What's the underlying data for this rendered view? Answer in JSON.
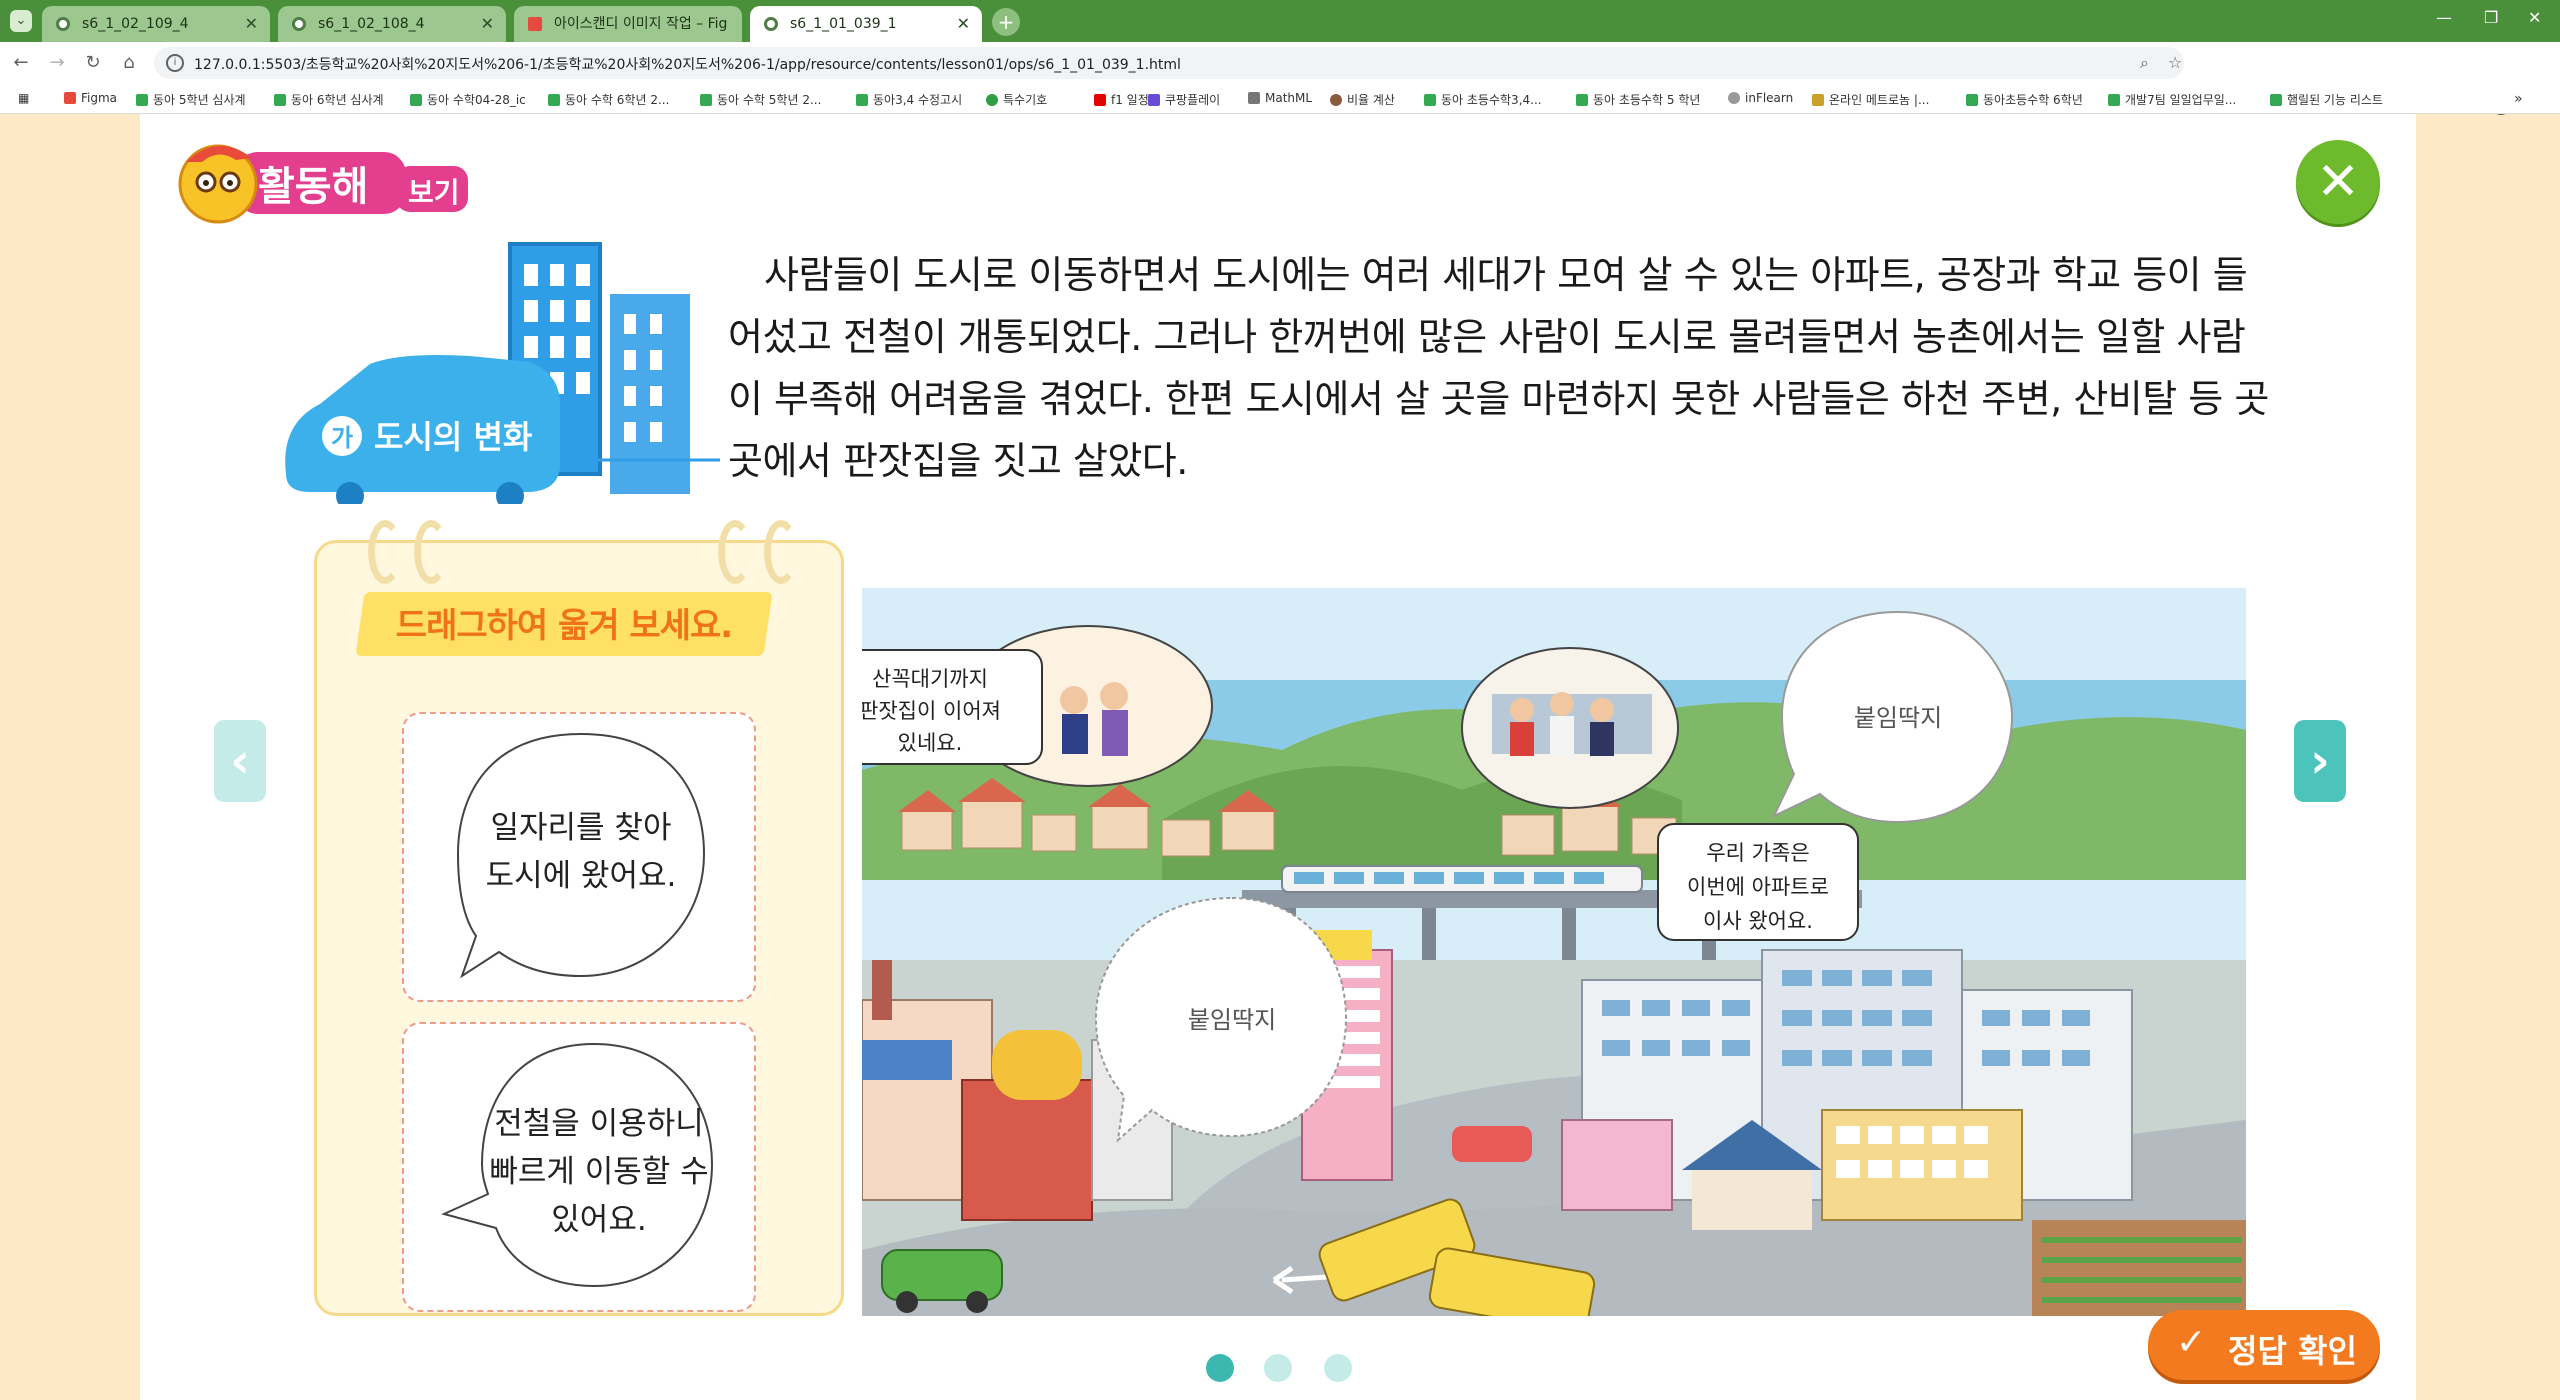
{
  "browser": {
    "tabs": [
      {
        "title": "s6_1_02_109_4"
      },
      {
        "title": "s6_1_02_108_4"
      },
      {
        "title": "아이스캔디 이미지 작업 – Fig"
      },
      {
        "title": "s6_1_01_039_1"
      }
    ],
    "url": "127.0.0.1:5503/초등학교%20사회%20지도서%206-1/초등학교%20사회%20지도서%206-1/app/resource/contents/lesson01/ops/s6_1_01_039_1.html",
    "bookmarks": [
      "Figma",
      "동아 5학년 심사계",
      "동아 6학년 심사계",
      "동아 수학04-28_ic",
      "동아 수학 6학년 2...",
      "동아 수학 5학년 2...",
      "동아3,4 수정고시",
      "특수기호",
      "f1 일정",
      "쿠팡플레이",
      "MathML",
      "비율 계산",
      "동아 초등수학3,4...",
      "동아 초등수학 5 학년",
      "inFlearn",
      "온라인 메트로놈 |...",
      "동아초등수학 6학년",
      "개발7팀 일일업무일...",
      "햄릴된 기능 리스트"
    ]
  },
  "header": {
    "activity_title": "활동해",
    "activity_sub": "보기",
    "section_badge": "가",
    "section_title": "도시의 변화"
  },
  "content": {
    "paragraph": "사람들이 도시로 이동하면서 도시에는 여러 세대가 모여 살 수 있는 아파트, 공장과 학교 등이 들어섰고 전철이 개통되었다. 그러나 한꺼번에 많은 사람이 도시로 몰려들면서 농촌에서는 일할 사람이 부족해 어려움을 겪었다. 한편 도시에서 살 곳을 마련하지 못한 사람들은 하천 주변, 산비탈 등 곳곳에서 판잣집을 짓고 살았다."
  },
  "drag_panel": {
    "title": "드래그하여 옮겨 보세요.",
    "cards": [
      {
        "lines": [
          "일자리를 찾아",
          "도시에 왔어요."
        ]
      },
      {
        "lines": [
          "전철을 이용하니",
          "빠르게 이동할 수",
          "있어요."
        ]
      }
    ]
  },
  "scene": {
    "bubble_hillside": [
      "산꼭대기까지",
      "판잣집이 이어져",
      "있네요."
    ],
    "bubble_family": [
      "우리 가족은",
      "이번에 아파트로",
      "이사 왔어요."
    ],
    "sticker_slot_label": "붙임딱지"
  },
  "controls": {
    "answer_label": "정답 확인",
    "pager_count": 3,
    "pager_active": 1
  },
  "colors": {
    "accent_orange": "#f47a1f",
    "close_green": "#6dbb2d",
    "arrow_teal": "#8fd8d0",
    "pager_active": "#3cb8b0",
    "pager_inactive": "#c4ebe7"
  }
}
